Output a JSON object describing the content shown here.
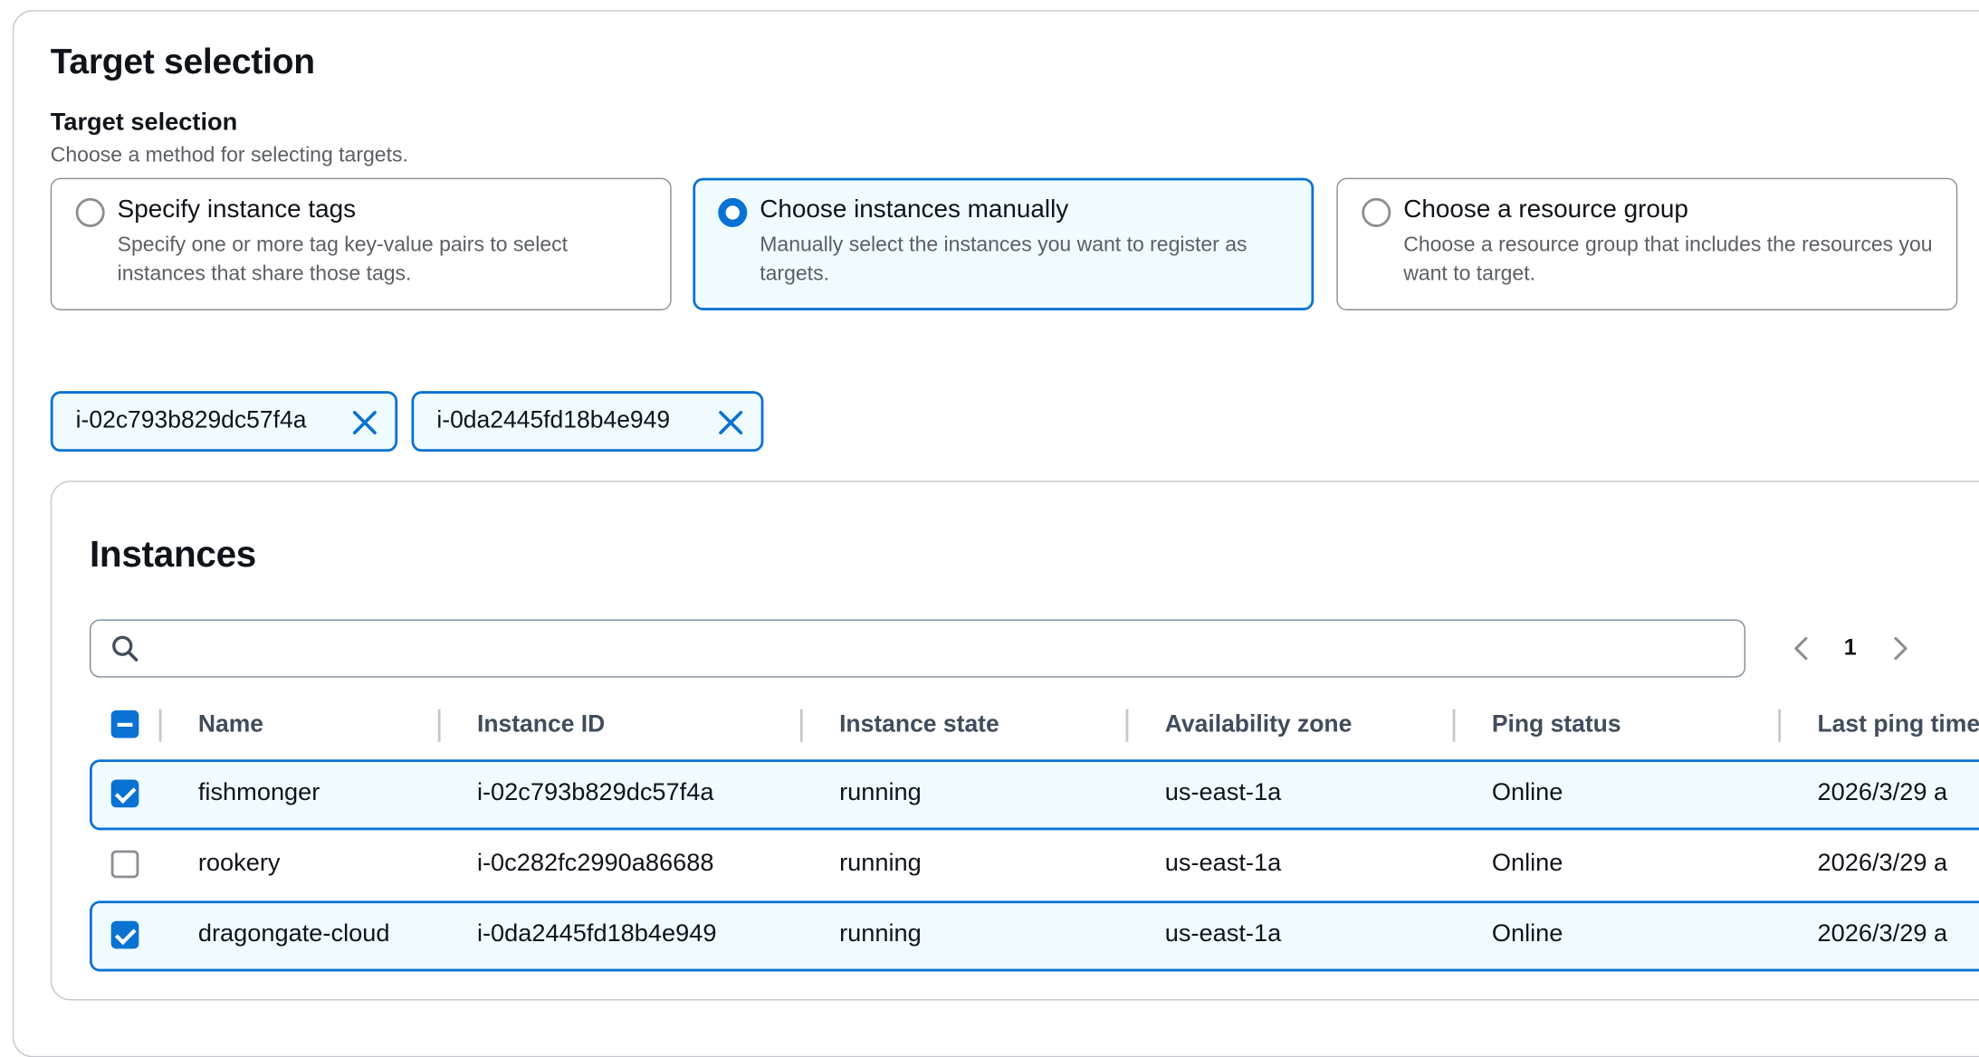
{
  "section": {
    "title": "Target selection",
    "field_label": "Target selection",
    "field_description": "Choose a method for selecting targets."
  },
  "options": [
    {
      "title": "Specify instance tags",
      "description": "Specify one or more tag key-value pairs to select instances that share those tags.",
      "selected": false
    },
    {
      "title": "Choose instances manually",
      "description": "Manually select the instances you want to register as targets.",
      "selected": true
    },
    {
      "title": "Choose a resource group",
      "description": "Choose a resource group that includes the resources you want to target.",
      "selected": false
    }
  ],
  "tokens": [
    {
      "label": "i-02c793b829dc57f4a",
      "icon": "close-icon"
    },
    {
      "label": "i-0da2445fd18b4e949",
      "icon": "close-icon"
    }
  ],
  "instances": {
    "title": "Instances",
    "search": {
      "value": "",
      "placeholder": "",
      "icon": "search-icon"
    },
    "pagination": {
      "current_page": "1"
    },
    "columns": [
      "Name",
      "Instance ID",
      "Instance state",
      "Availability zone",
      "Ping status",
      "Last ping time"
    ],
    "rows": [
      {
        "selected": true,
        "name": "fishmonger",
        "instance_id": "i-02c793b829dc57f4a",
        "state": "running",
        "zone": "us-east-1a",
        "ping": "Online",
        "last_ping": "2026/3/29 a"
      },
      {
        "selected": false,
        "name": "rookery",
        "instance_id": "i-0c282fc2990a86688",
        "state": "running",
        "zone": "us-east-1a",
        "ping": "Online",
        "last_ping": "2026/3/29 a"
      },
      {
        "selected": true,
        "name": "dragongate-cloud",
        "instance_id": "i-0da2445fd18b4e949",
        "state": "running",
        "zone": "us-east-1a",
        "ping": "Online",
        "last_ping": "2026/3/29 a"
      }
    ]
  },
  "colors": {
    "accent": "#0972d3",
    "selected_bg": "#f0fbff",
    "border": "#c6c6cd",
    "muted_text": "#5b5f66"
  }
}
